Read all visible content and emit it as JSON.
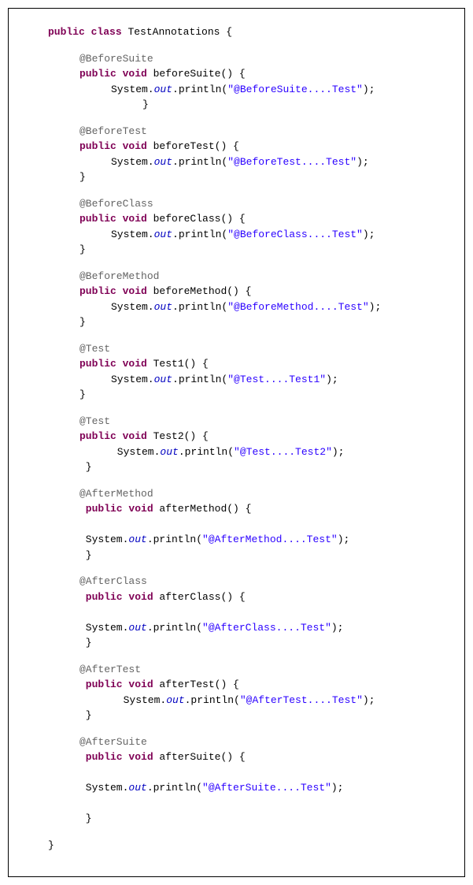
{
  "class": {
    "keywords": "public class",
    "name": "TestAnnotations",
    "open": " {",
    "close": "}"
  },
  "methods": {
    "beforeSuite": {
      "annotation": "@BeforeSuite",
      "decl": "public void",
      "name": " beforeSuite() {",
      "printCall": "System.",
      "out": "out",
      "println": ".println(",
      "msg": "\"@BeforeSuite....Test\"",
      "end": ");",
      "close": "}"
    },
    "beforeTest": {
      "annotation": "@BeforeTest",
      "decl": "public void",
      "name": " beforeTest() {",
      "printCall": "System.",
      "out": "out",
      "println": ".println(",
      "msg": "\"@BeforeTest....Test\"",
      "end": ");",
      "close": "}"
    },
    "beforeClass": {
      "annotation": "@BeforeClass",
      "decl": "public void",
      "name": " beforeClass() {",
      "printCall": "System.",
      "out": "out",
      "println": ".println(",
      "msg": "\"@BeforeClass....Test\"",
      "end": ");",
      "close": "}"
    },
    "beforeMethod": {
      "annotation": "@BeforeMethod",
      "decl": "public void",
      "name": " beforeMethod() {",
      "printCall": "System.",
      "out": "out",
      "println": ".println(",
      "msg": "\"@BeforeMethod....Test\"",
      "end": ");",
      "close": "}"
    },
    "test1": {
      "annotation": "@Test",
      "decl": "public void",
      "name": " Test1() {",
      "printCall": "System.",
      "out": "out",
      "println": ".println(",
      "msg": "\"@Test....Test1\"",
      "end": ");",
      "close": "}"
    },
    "test2": {
      "annotation": "@Test",
      "decl": "public void",
      "name": " Test2() {",
      "printCall": " System.",
      "out": "out",
      "println": ".println(",
      "msg": "\"@Test....Test2\"",
      "end": ");",
      "close": " }"
    },
    "afterMethod": {
      "annotation": "@AfterMethod",
      "decl": " public void",
      "name": " afterMethod() {",
      "printCall": " System.",
      "out": "out",
      "println": ".println(",
      "msg": "\"@AfterMethod....Test\"",
      "end": ");",
      "close": " }"
    },
    "afterClass": {
      "annotation": "@AfterClass",
      "decl": " public void",
      "name": " afterClass() {",
      "printCall": " System.",
      "out": "out",
      "println": ".println(",
      "msg": "\"@AfterClass....Test\"",
      "end": ");",
      "close": " }"
    },
    "afterTest": {
      "annotation": "@AfterTest",
      "decl": " public void",
      "name": " afterTest() {",
      "printCall": "  System.",
      "out": "out",
      "println": ".println(",
      "msg": "\"@AfterTest....Test\"",
      "end": ");",
      "close": " }"
    },
    "afterSuite": {
      "annotation": "@AfterSuite",
      "decl": " public void",
      "name": " afterSuite() {",
      "printCall": " System.",
      "out": "out",
      "println": ".println(",
      "msg": "\"@AfterSuite....Test\"",
      "end": ");",
      "close": " }"
    }
  }
}
